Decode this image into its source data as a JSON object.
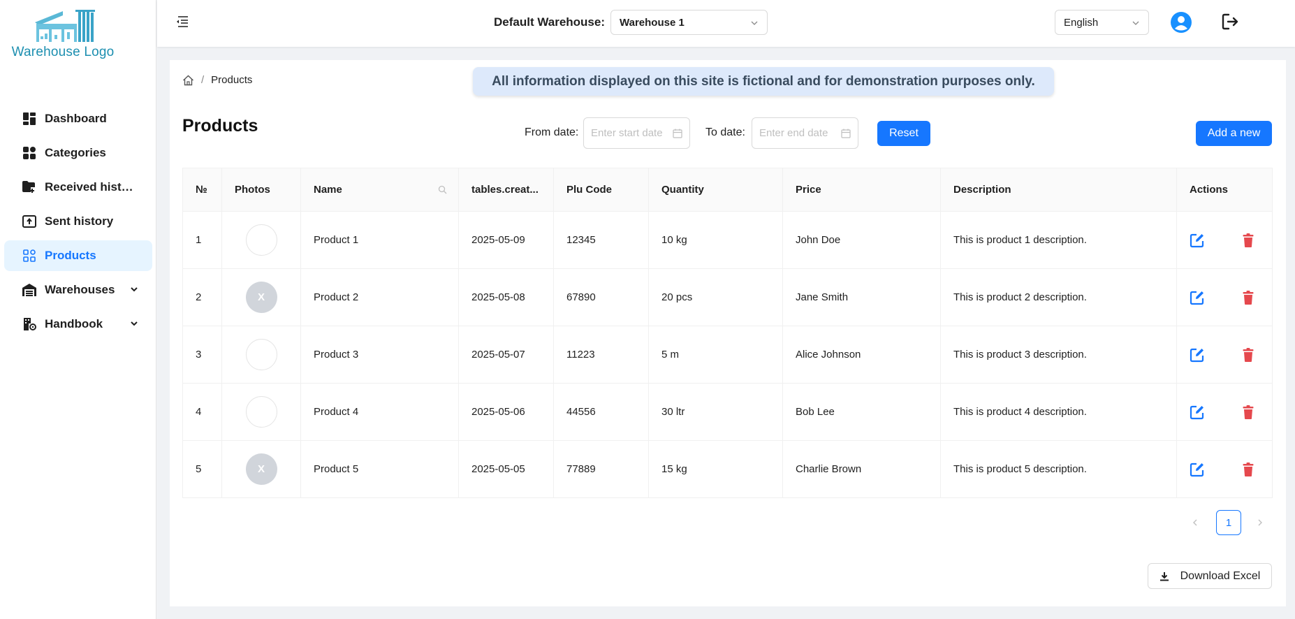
{
  "brand": {
    "logo_text": "Warehouse Logo"
  },
  "sidebar": {
    "items": [
      {
        "label": "Dashboard",
        "icon": "dashboard-icon"
      },
      {
        "label": "Categories",
        "icon": "grid-icon"
      },
      {
        "label": "Received histo...",
        "icon": "folder-in-icon"
      },
      {
        "label": "Sent history",
        "icon": "upload-box-icon"
      },
      {
        "label": "Products",
        "icon": "app-grid-icon",
        "active": true
      },
      {
        "label": "Warehouses",
        "icon": "warehouse-icon",
        "expandable": true
      },
      {
        "label": "Handbook",
        "icon": "building-gear-icon",
        "expandable": true
      }
    ]
  },
  "header": {
    "warehouse_label": "Default Warehouse:",
    "warehouse_value": "Warehouse 1",
    "language_value": "English"
  },
  "breadcrumb": {
    "current": "Products"
  },
  "notice": "All information displayed on this site is fictional and for demonstration purposes only.",
  "page": {
    "title": "Products",
    "from_label": "From date:",
    "from_placeholder": "Enter start date",
    "to_label": "To date:",
    "to_placeholder": "Enter end date",
    "reset_label": "Reset",
    "add_label": "Add a new",
    "download_label": "Download Excel"
  },
  "table": {
    "columns": [
      "№",
      "Photos",
      "Name",
      "tables.creat...",
      "Plu Code",
      "Quantity",
      "Price",
      "Description",
      "Actions"
    ],
    "rows": [
      {
        "no": "1",
        "photo": "",
        "photo_type": "empty",
        "name": "Product 1",
        "created": "2025-05-09",
        "plu": "12345",
        "qty": "10 kg",
        "price": "John Doe",
        "desc": "This is product 1 description."
      },
      {
        "no": "2",
        "photo": "X",
        "photo_type": "x",
        "name": "Product 2",
        "created": "2025-05-08",
        "plu": "67890",
        "qty": "20 pcs",
        "price": "Jane Smith",
        "desc": "This is product 2 description."
      },
      {
        "no": "3",
        "photo": "",
        "photo_type": "empty",
        "name": "Product 3",
        "created": "2025-05-07",
        "plu": "11223",
        "qty": "5 m",
        "price": "Alice Johnson",
        "desc": "This is product 3 description."
      },
      {
        "no": "4",
        "photo": "",
        "photo_type": "empty",
        "name": "Product 4",
        "created": "2025-05-06",
        "plu": "44556",
        "qty": "30 ltr",
        "price": "Bob Lee",
        "desc": "This is product 4 description."
      },
      {
        "no": "5",
        "photo": "X",
        "photo_type": "x",
        "name": "Product 5",
        "created": "2025-05-05",
        "plu": "77889",
        "qty": "15 kg",
        "price": "Charlie Brown",
        "desc": "This is product 5 description."
      }
    ]
  },
  "pagination": {
    "current": "1"
  },
  "colors": {
    "primary": "#1677ff",
    "danger": "#e5484d",
    "logo": "#1d8fb0",
    "notice_bg": "#dde9fb"
  }
}
